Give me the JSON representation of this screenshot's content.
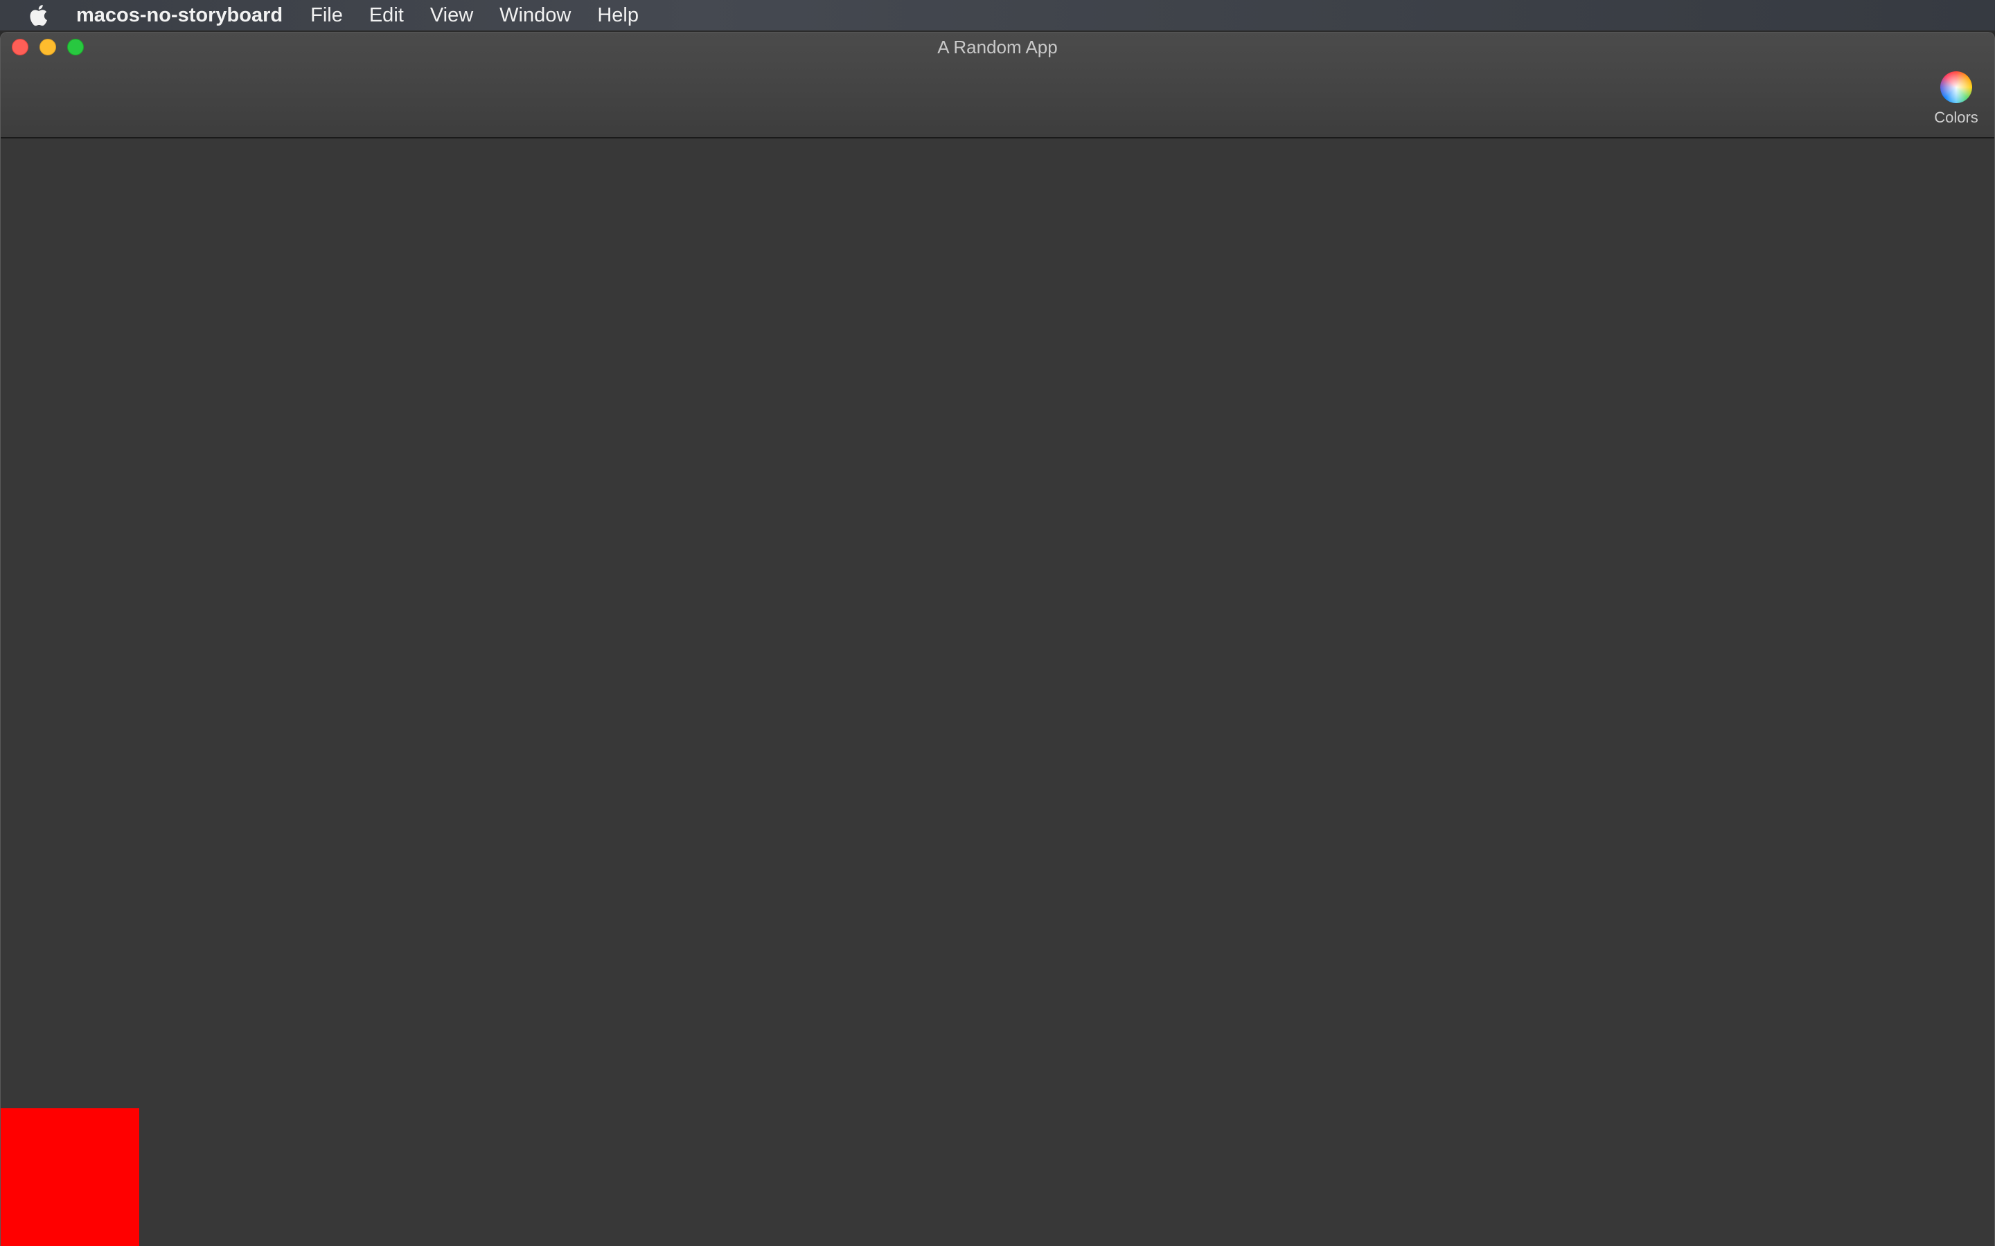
{
  "menubar": {
    "app_name": "macos-no-storyboard",
    "items": [
      "File",
      "Edit",
      "View",
      "Window",
      "Help"
    ],
    "apple_icon": "apple-logo-icon"
  },
  "window": {
    "title": "A Random App",
    "traffic_lights": {
      "close_color": "#ff5f57",
      "minimize_color": "#febc2e",
      "zoom_color": "#28c840"
    },
    "toolbar": {
      "colors_label": "Colors",
      "colors_icon": "color-wheel-icon"
    },
    "content": {
      "background": "#383838",
      "square_color": "#ff0000"
    }
  }
}
